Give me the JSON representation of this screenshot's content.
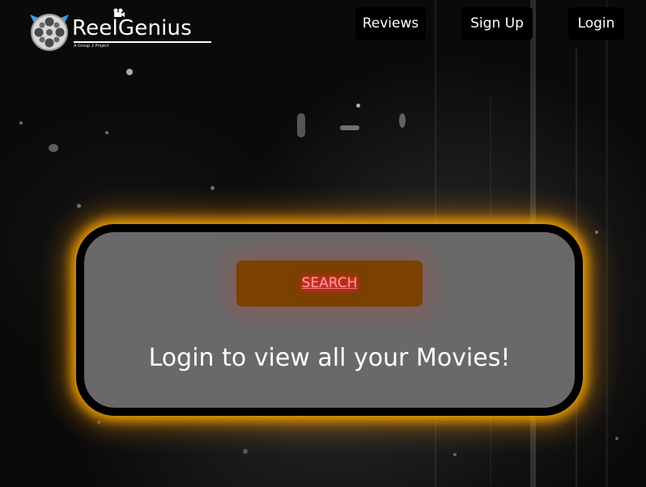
{
  "brand": {
    "name": "ReelGenius",
    "tagline": "A Group 2 Project"
  },
  "nav": {
    "reviews_label": "Reviews",
    "signup_label": "Sign Up",
    "login_label": "Login"
  },
  "main": {
    "search_label": "SEARCH",
    "message": "Login to view all your Movies!"
  },
  "colors": {
    "card_background": "#696969",
    "card_glow": "#ffaa00",
    "search_button": "#7a4100",
    "search_neon": "#ff2b3b",
    "logo_accent": "#3aa0e0"
  },
  "icons": {
    "logo": "film-reel-icon",
    "camera": "movie-camera-icon"
  }
}
